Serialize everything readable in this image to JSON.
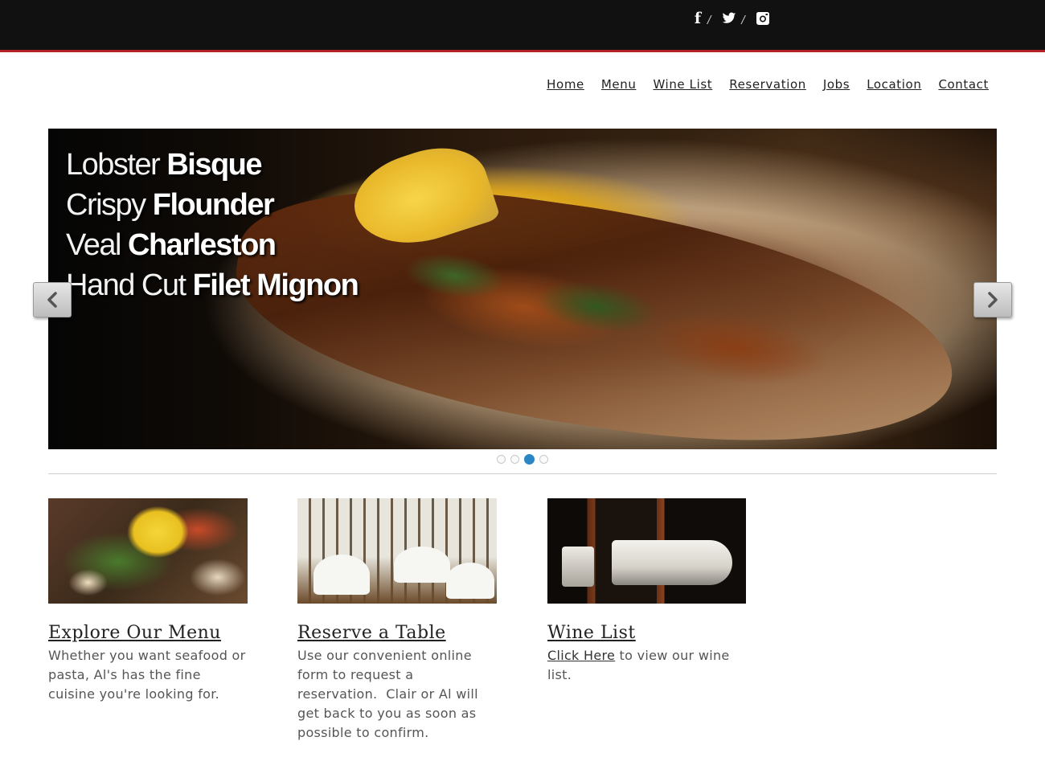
{
  "header": {
    "social": [
      {
        "name": "facebook-icon",
        "glyph": "f"
      },
      {
        "name": "twitter-icon",
        "glyph": ""
      },
      {
        "name": "instagram-icon",
        "glyph": ""
      }
    ],
    "separator": "/"
  },
  "nav": {
    "items": [
      "Home",
      "Menu",
      "Wine List",
      "Reservation",
      "Jobs",
      "Location",
      "Contact"
    ]
  },
  "slider": {
    "lines": [
      {
        "light": "Lobster ",
        "bold": "Bisque"
      },
      {
        "light": "Crispy ",
        "bold": "Flounder"
      },
      {
        "light": "Veal ",
        "bold": "Charleston"
      },
      {
        "light": "Hand Cut ",
        "bold": "Filet Mignon"
      }
    ],
    "slide_count": 4,
    "active_index": 2
  },
  "cards": [
    {
      "title": "Explore Our Menu",
      "text": "Whether you want seafood or pasta, Al's has the fine cuisine you're looking for."
    },
    {
      "title": "Reserve a Table",
      "text": "Use our convenient online form to request a reservation.  Clair or Al will get back to you as soon as possible to confirm."
    },
    {
      "title": "Wine List",
      "link": "Click Here",
      "text": " to view our wine list."
    }
  ],
  "colors": {
    "topbar": "#111111",
    "accent_border": "#b32025",
    "active_dot": "#2b86c5"
  }
}
